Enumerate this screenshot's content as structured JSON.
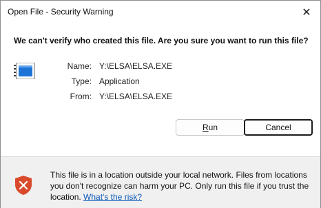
{
  "window": {
    "title": "Open File - Security Warning",
    "close_glyph": "✕"
  },
  "prompt": {
    "question": "We can't verify who created this file. Are you sure you want to run this file?"
  },
  "file_info": {
    "icon": "application-icon",
    "rows": [
      {
        "label": "Name:",
        "value": "Y:\\ELSA\\ELSA.EXE"
      },
      {
        "label": "Type:",
        "value": "Application"
      },
      {
        "label": "From:",
        "value": "Y:\\ELSA\\ELSA.EXE"
      }
    ]
  },
  "buttons": {
    "run_accel": "R",
    "run_rest": "un",
    "cancel": "Cancel"
  },
  "footer": {
    "icon": "warning-shield-icon",
    "message": "This file is in a location outside your local network. Files from locations you don't recognize can harm your PC. Only run this file if you trust the location.",
    "link": "What's the risk?"
  },
  "colors": {
    "shield": "#d84a2b",
    "link": "#0a58b8",
    "footer_bg": "#f0f0f0",
    "icon_blue": "#1e74d6"
  }
}
